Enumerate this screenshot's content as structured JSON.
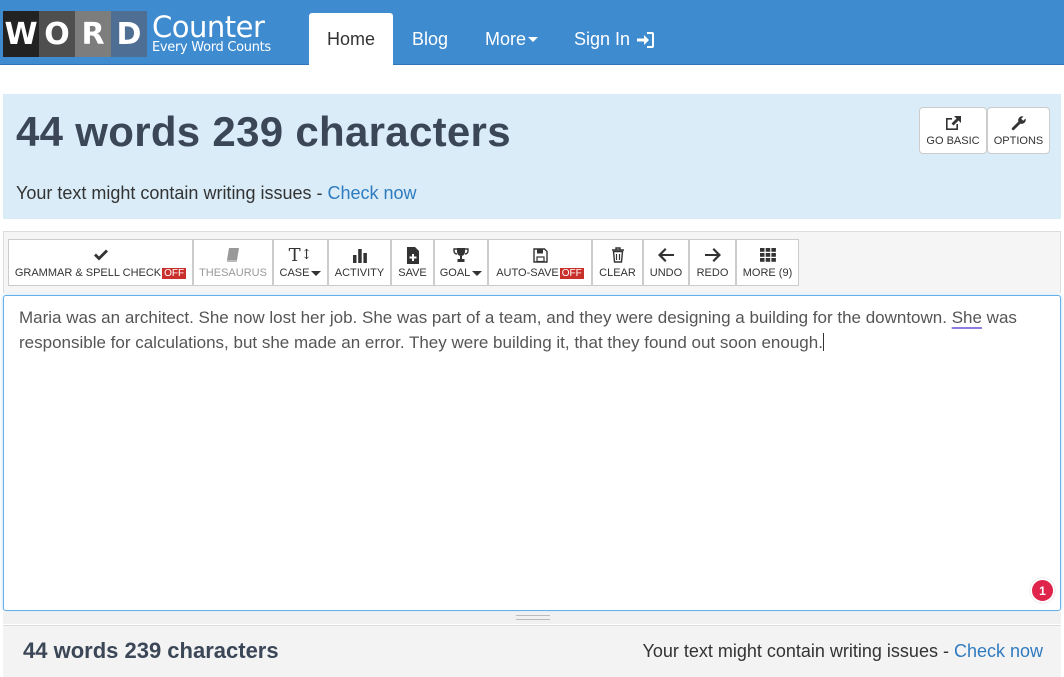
{
  "logo": {
    "letters": [
      "W",
      "O",
      "R",
      "D"
    ],
    "name": "Counter",
    "tagline": "Every Word Counts"
  },
  "nav": {
    "home": "Home",
    "blog": "Blog",
    "more": "More",
    "sign_in": "Sign In"
  },
  "banner": {
    "headline": "44 words 239 characters",
    "issue_text": "Your text might contain writing issues - ",
    "issue_link": "Check now",
    "go_basic": "GO BASIC",
    "options": "OPTIONS"
  },
  "toolbar": {
    "grammar": "GRAMMAR & SPELL CHECK",
    "grammar_badge": "OFF",
    "thesaurus": "THESAURUS",
    "case": "CASE",
    "activity": "ACTIVITY",
    "save": "SAVE",
    "goal": "GOAL",
    "autosave": "AUTO-SAVE",
    "autosave_badge": "OFF",
    "clear": "CLEAR",
    "undo": "UNDO",
    "redo": "REDO",
    "more": "MORE (9)"
  },
  "editor": {
    "text_before": "Maria was an architect. She now lost her job. She was part of a team, and they were designing a building for the downtown. ",
    "text_flagged": "She",
    "text_after": " was responsible for calculations, but she made an error. They were building it, that they found out soon enough.",
    "error_count": "1"
  },
  "footer": {
    "count": "44 words 239 characters",
    "issue_text": "Your text might contain writing issues - ",
    "issue_link": "Check now"
  },
  "colors": {
    "nav": "#3e8bd0",
    "banner": "#d9ecf7",
    "link": "#2f7bbf",
    "badge_red": "#c9302c",
    "error_badge": "#e0234a"
  }
}
